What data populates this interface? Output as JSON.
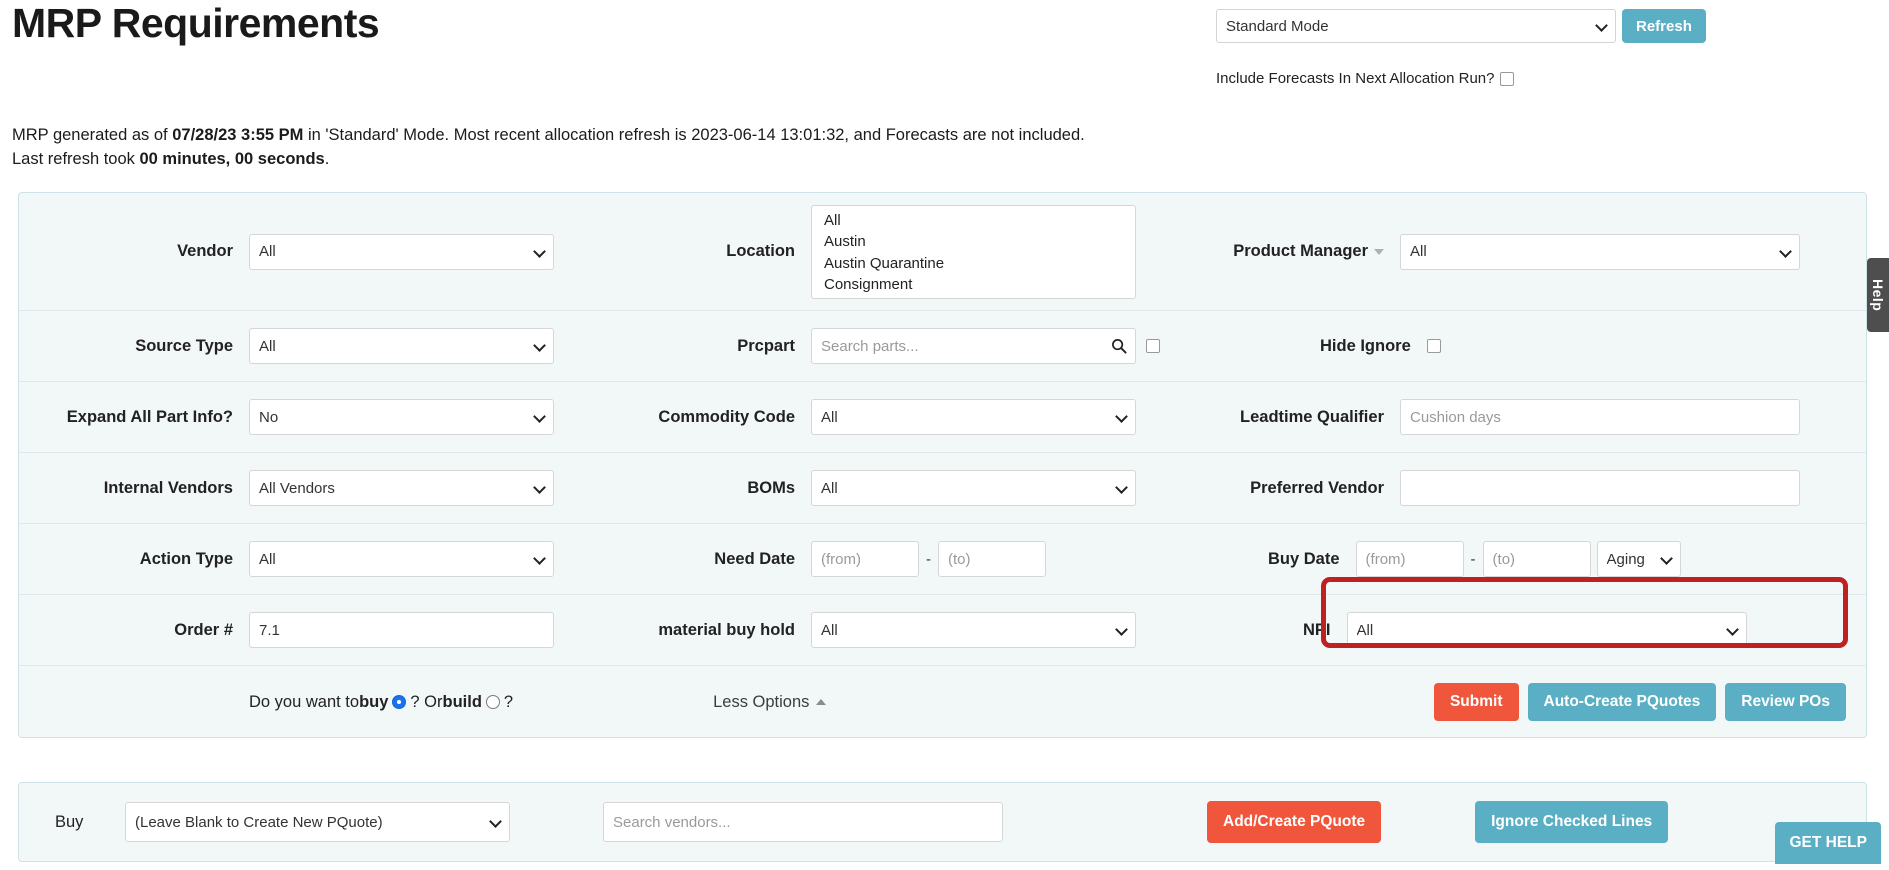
{
  "header": {
    "title": "MRP Requirements",
    "mode_value": "Standard Mode",
    "refresh_label": "Refresh",
    "forecast_label": "Include Forecasts In Next Allocation Run?"
  },
  "status": {
    "line1_a": "MRP generated as of ",
    "line1_b": "07/28/23 3:55 PM",
    "line1_c": " in 'Standard' Mode. Most recent allocation refresh is 2023-06-14 13:01:32, and Forecasts are not included.",
    "line2_a": "Last refresh took ",
    "line2_b": "00 minutes, 00 seconds",
    "line2_c": "."
  },
  "filters": {
    "vendor_label": "Vendor",
    "vendor_value": "All",
    "location_label": "Location",
    "location_options": [
      "All",
      "Austin",
      "Austin Quarantine",
      "Consignment"
    ],
    "product_manager_label": "Product Manager",
    "product_manager_value": "All",
    "source_type_label": "Source Type",
    "source_type_value": "All",
    "prcpart_label": "Prcpart",
    "prcpart_placeholder": "Search parts...",
    "hide_ignore_label": "Hide Ignore",
    "expand_all_label": "Expand All Part Info?",
    "expand_all_value": "No",
    "commodity_code_label": "Commodity Code",
    "commodity_code_value": "All",
    "leadtime_label": "Leadtime Qualifier",
    "leadtime_placeholder": "Cushion days",
    "internal_vendors_label": "Internal Vendors",
    "internal_vendors_value": "All Vendors",
    "boms_label": "BOMs",
    "boms_value": "All",
    "preferred_vendor_label": "Preferred Vendor",
    "preferred_vendor_value": "",
    "action_type_label": "Action Type",
    "action_type_value": "All",
    "need_date_label": "Need Date",
    "date_from_placeholder": "(from)",
    "date_to_placeholder": "(to)",
    "date_separator": "-",
    "buy_date_label": "Buy Date",
    "aging_value": "Aging",
    "order_label": "Order #",
    "order_value": "7.1",
    "material_buy_hold_label": "material buy hold",
    "material_buy_hold_value": "All",
    "npi_label": "NPI",
    "npi_value": "All",
    "npi_highlight_color": "#bf2020"
  },
  "actions": {
    "question_a": "Do you want to ",
    "question_buy": "buy",
    "question_mid": " ? Or ",
    "question_build": "build",
    "question_end": " ?",
    "buy_selected": true,
    "less_options": "Less Options",
    "submit": "Submit",
    "auto_create_pquotes": "Auto-Create PQuotes",
    "review_pos": "Review POs"
  },
  "buy_panel": {
    "buy_label": "Buy",
    "pquote_value": "(Leave Blank to Create New PQuote)",
    "vendor_search_placeholder": "Search vendors...",
    "add_create_pquote": "Add/Create PQuote",
    "ignore_checked_lines": "Ignore Checked Lines"
  },
  "side": {
    "help_tab": "Help",
    "get_help": "GET HELP"
  },
  "colors": {
    "teal": "#5bafc4",
    "red": "#f0563c",
    "panel_bg": "#f2f7f8",
    "highlight": "#bf2020"
  }
}
